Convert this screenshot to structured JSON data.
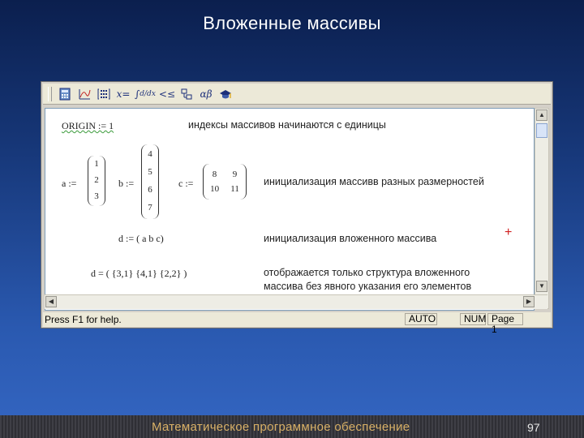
{
  "slide": {
    "title": "Вложенные массивы"
  },
  "toolbar": {
    "items": [
      "calculator-icon",
      "graph-icon",
      "matrix-icon",
      "evaluation-icon",
      "calculus-icon",
      "boolean-icon",
      "programming-icon",
      "greek-icon",
      "symbolic-icon"
    ]
  },
  "doc": {
    "origin": "ORIGIN := 1",
    "origin_note": "индексы массивов начинаются с единицы",
    "a_label": "a :=",
    "a_values": [
      "1",
      "2",
      "3"
    ],
    "b_label": "b :=",
    "b_values": [
      "4",
      "5",
      "6",
      "7"
    ],
    "c_label": "c :=",
    "c_row1": [
      "8",
      "9"
    ],
    "c_row2": [
      "10",
      "11"
    ],
    "init_note": "инициализация массивв разных размерностей",
    "d_def": "d := ( a  b  c)",
    "d_note": "инициализация вложенного массива",
    "d_result": "d = ( {3,1}   {4,1}   {2,2} )",
    "result_note_line1": "отображается только структура вложенного",
    "result_note_line2": "массива без явного указания его элементов",
    "plus": "+"
  },
  "statusbar": {
    "help": "Press F1 for help.",
    "mode": "AUTO",
    "num": "NUM",
    "page": "Page 1"
  },
  "footer": {
    "text": "Математическое программное обеспечение",
    "page_number": "97"
  }
}
